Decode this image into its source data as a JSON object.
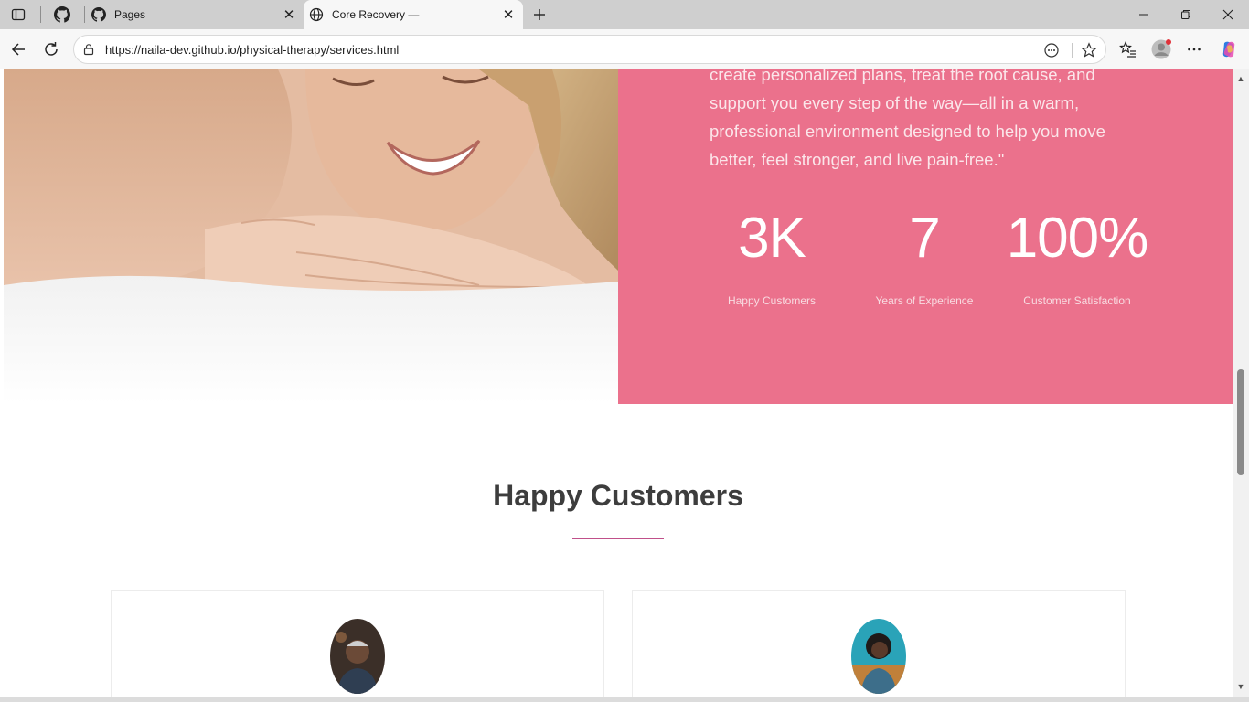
{
  "browser": {
    "tabs": [
      {
        "title": "Pages",
        "icon": "github-icon"
      },
      {
        "title": "Core Recovery —",
        "icon": "globe-icon"
      }
    ],
    "url": "https://naila-dev.github.io/physical-therapy/services.html"
  },
  "about": {
    "quote": "create personalized plans, treat the root cause, and support you every step of the way—all in a warm, professional environment designed to help you move better, feel stronger, and live pain-free.\"",
    "panel_color": "#eb718c",
    "stats": [
      {
        "value": "3K",
        "label": "Happy Customers"
      },
      {
        "value": "7",
        "label": "Years of Experience"
      },
      {
        "value": "100%",
        "label": "Customer Satisfaction"
      }
    ]
  },
  "testimonials": {
    "title": "Happy Customers",
    "accent": "#c0508a"
  }
}
